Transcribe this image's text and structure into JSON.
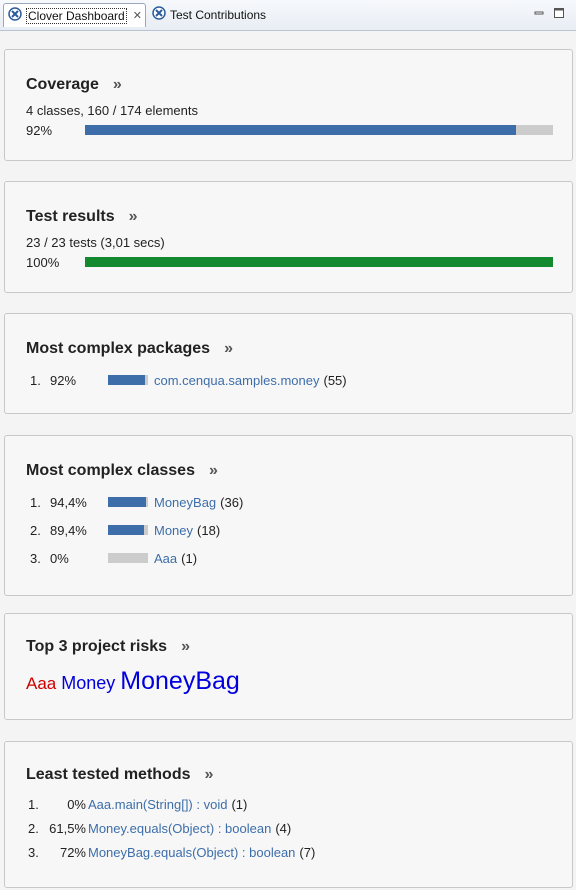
{
  "tabs": [
    {
      "label": "Clover Dashboard",
      "active": true,
      "icon": "clover-icon"
    },
    {
      "label": "Test Contributions",
      "active": false,
      "icon": "clover-icon"
    }
  ],
  "coverage": {
    "title": "Coverage",
    "more": "»",
    "summary": "4 classes, 160 / 174 elements",
    "percent_label": "92%",
    "progress": 0.92,
    "bar_color": "#3d6eaa"
  },
  "test_results": {
    "title": "Test results",
    "more": "»",
    "summary": "23 / 23 tests (3,01 secs)",
    "percent_label": "100%",
    "progress": 1.0,
    "bar_color": "#138a2f"
  },
  "complex_packages": {
    "title": "Most complex packages",
    "more": "»",
    "items": [
      {
        "index": "1.",
        "percent": "92%",
        "coverage": 0.92,
        "name": "com.cenqua.samples.money",
        "count": "(55)"
      }
    ]
  },
  "complex_classes": {
    "title": "Most complex classes",
    "more": "»",
    "items": [
      {
        "index": "1.",
        "percent": "94,4%",
        "coverage": 0.944,
        "name": "MoneyBag",
        "count": "(36)"
      },
      {
        "index": "2.",
        "percent": "89,4%",
        "coverage": 0.894,
        "name": "Money",
        "count": "(18)"
      },
      {
        "index": "3.",
        "percent": "0%",
        "coverage": 0.0,
        "name": "Aaa",
        "count": "(1)"
      }
    ]
  },
  "project_risks": {
    "title": "Top 3 project risks",
    "more": "»",
    "items": [
      {
        "name": "Aaa",
        "color": "#cc0000"
      },
      {
        "name": "Money",
        "color": "#0000dd"
      },
      {
        "name": "MoneyBag",
        "color": "#0000dd"
      }
    ]
  },
  "least_tested": {
    "title": "Least tested methods",
    "more": "»",
    "items": [
      {
        "index": "1.",
        "percent": "0%",
        "name": "Aaa.main(String[]) : void",
        "count": "(1)"
      },
      {
        "index": "2.",
        "percent": "61,5%",
        "name": "Money.equals(Object) : boolean",
        "count": "(4)"
      },
      {
        "index": "3.",
        "percent": "72%",
        "name": "MoneyBag.equals(Object) : boolean",
        "count": "(7)"
      }
    ]
  }
}
